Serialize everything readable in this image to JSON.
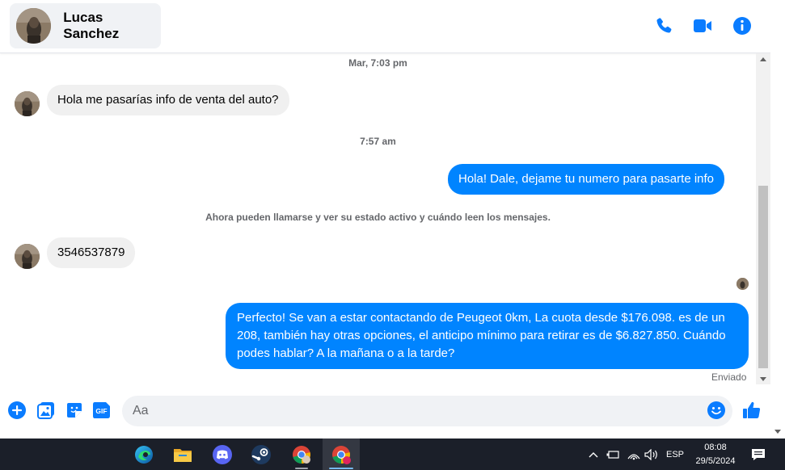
{
  "conversation": {
    "contact_name": "Lucas Sanchez"
  },
  "header_icons": [
    "phone-icon",
    "video-camera-icon",
    "info-icon"
  ],
  "messages": {
    "timestamp_1": "Mar, 7:03 pm",
    "incoming_1": "Hola me pasarías info de venta del auto?",
    "timestamp_2": "7:57 am",
    "outgoing_1": "Hola! Dale, dejame tu numero para pasarte info",
    "system_notice": "Ahora pueden llamarse y ver su estado activo y cuándo leen los mensajes.",
    "incoming_2": "3546537879",
    "outgoing_2": "Perfecto!  Se van a estar contactando de Peugeot 0km, La cuota desde $176.098. es de un 208, también hay otras opciones, el anticipo mínimo para retirar es de $6.827.850. Cuándo podes hablar? A la mañana o a la tarde?",
    "delivery_status": "Enviado"
  },
  "composer": {
    "placeholder": "Aa",
    "icons": [
      "add-icon",
      "image-icon",
      "sticker-icon",
      "gif-icon",
      "emoji-icon",
      "like-icon"
    ],
    "gif_label": "GIF"
  },
  "colors": {
    "accent": "#0084ff",
    "incoming_bubble": "#f0f0f0",
    "icon_blue": "#0a7cff",
    "taskbar": "#1b1f29"
  },
  "taskbar": {
    "apps": [
      "edge-icon",
      "file-explorer-icon",
      "discord-icon",
      "steam-icon",
      "chrome-icon",
      "chrome-profile-icon"
    ],
    "language": "ESP",
    "time": "08:08",
    "date": "29/5/2024"
  }
}
